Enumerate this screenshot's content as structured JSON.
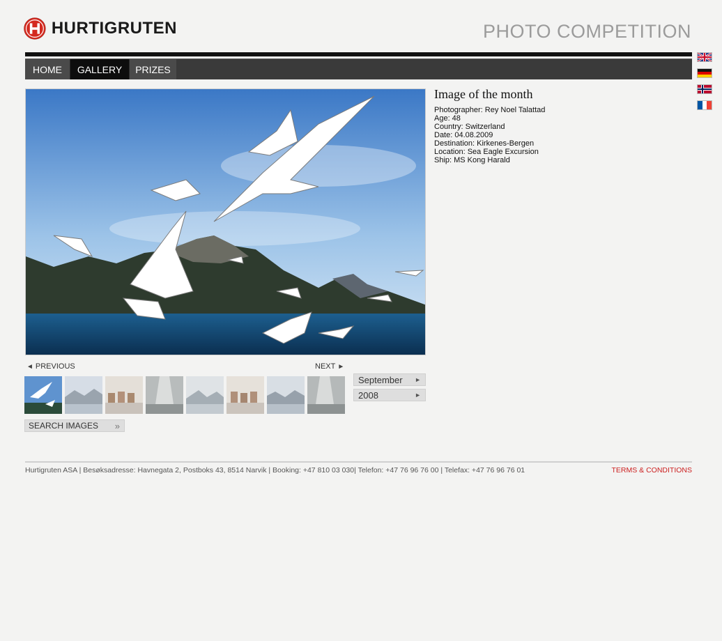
{
  "brand": {
    "name": "HURTIGRUTEN",
    "tagline": "PHOTO COMPETITION"
  },
  "nav": {
    "items": [
      {
        "label": "HOME"
      },
      {
        "label": "GALLERY"
      },
      {
        "label": "PRIZES"
      }
    ]
  },
  "languages": [
    "english-flag-icon",
    "german-flag-icon",
    "norwegian-flag-icon",
    "french-flag-icon"
  ],
  "image_info": {
    "title": "Image of the month",
    "lines": [
      "Photographer: Rey Noel Talattad",
      "Age: 48",
      "Country: Switzerland",
      "Date: 04.08.2009",
      "Destination: Kirkenes-Bergen",
      "Location: Sea Eagle Excursion",
      "Ship: MS Kong Harald"
    ]
  },
  "pager": {
    "previous": "PREVIOUS",
    "next": "NEXT"
  },
  "filters": {
    "month": "September",
    "year": "2008"
  },
  "search_label": "SEARCH IMAGES",
  "footer": {
    "text": "Hurtigruten ASA  |  Besøksadresse: Havnegata 2, Postboks 43, 8514 Narvik | Booking: +47 810 03 030|  Telefon: +47 76 96 76 00 | Telefax: +47 76 96 76 01",
    "terms": "TERMS & CONDITIONS"
  },
  "colors": {
    "accent": "#cc1f1f",
    "nav_bg": "#3a3a3a",
    "nav_active": "#0d0d0d"
  }
}
